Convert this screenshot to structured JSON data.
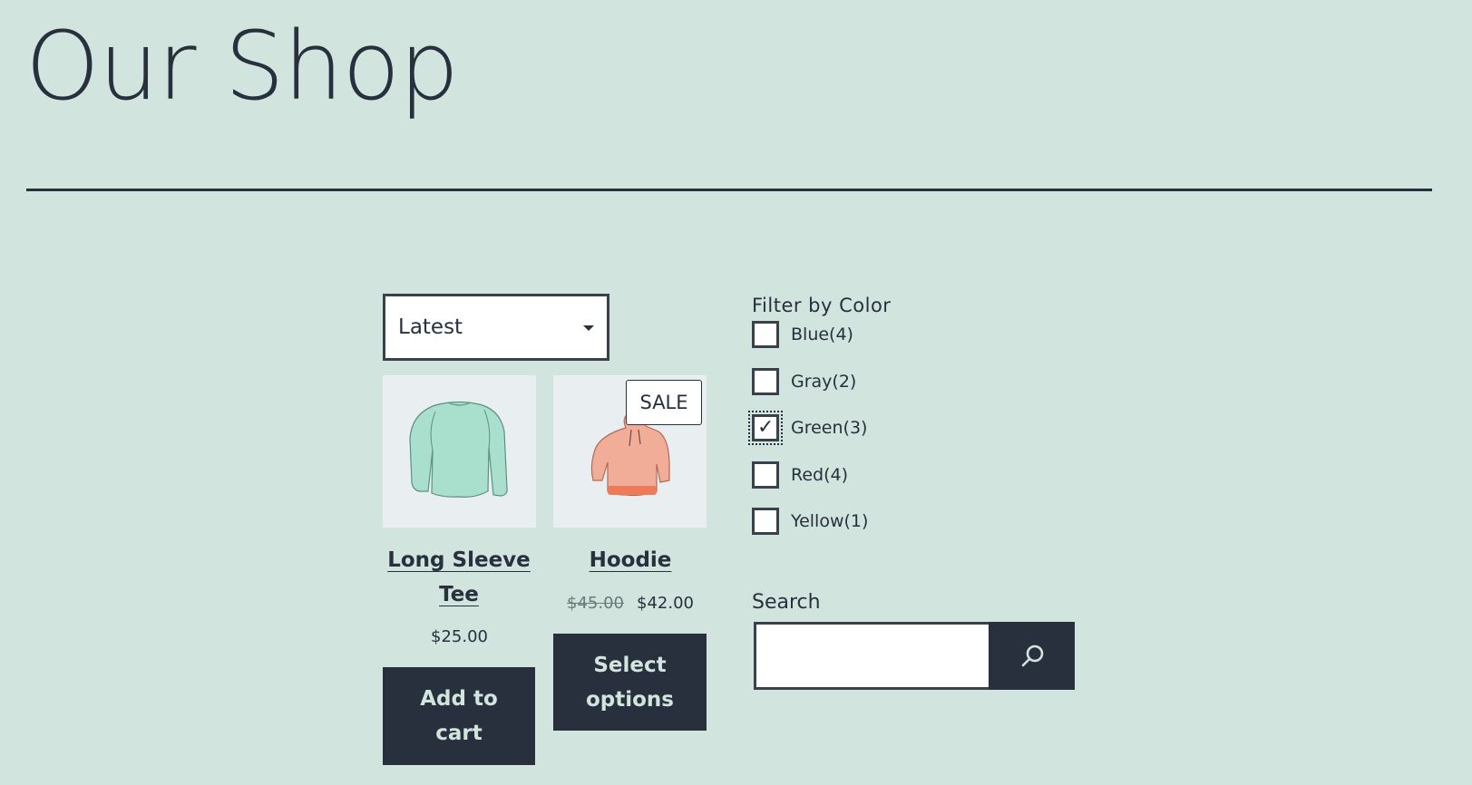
{
  "page": {
    "title": "Our Shop",
    "background_color": "#d1e4dd",
    "text_color": "#28303d"
  },
  "sort": {
    "selected": "Latest",
    "icon": "caret-down-icon"
  },
  "products": [
    {
      "name": "Long Sleeve Tee",
      "price": "$25.00",
      "button_label": "Add to cart",
      "image": "long-sleeve-tee-illustration",
      "image_color": "#9dd9c6"
    },
    {
      "name": "Hoodie",
      "badge": "SALE",
      "old_price": "$45.00",
      "price": "$42.00",
      "button_label": "Select options",
      "image": "hoodie-illustration",
      "image_color": "#f2a890"
    }
  ],
  "filter": {
    "title": "Filter by Color",
    "options": [
      {
        "label": "Blue(4)",
        "checked": false
      },
      {
        "label": "Gray(2)",
        "checked": false
      },
      {
        "label": "Green(3)",
        "checked": true
      },
      {
        "label": "Red(4)",
        "checked": false
      },
      {
        "label": "Yellow(1)",
        "checked": false
      }
    ],
    "check_glyph": "✓"
  },
  "search": {
    "label": "Search",
    "value": "",
    "placeholder": "",
    "icon": "search-icon"
  }
}
